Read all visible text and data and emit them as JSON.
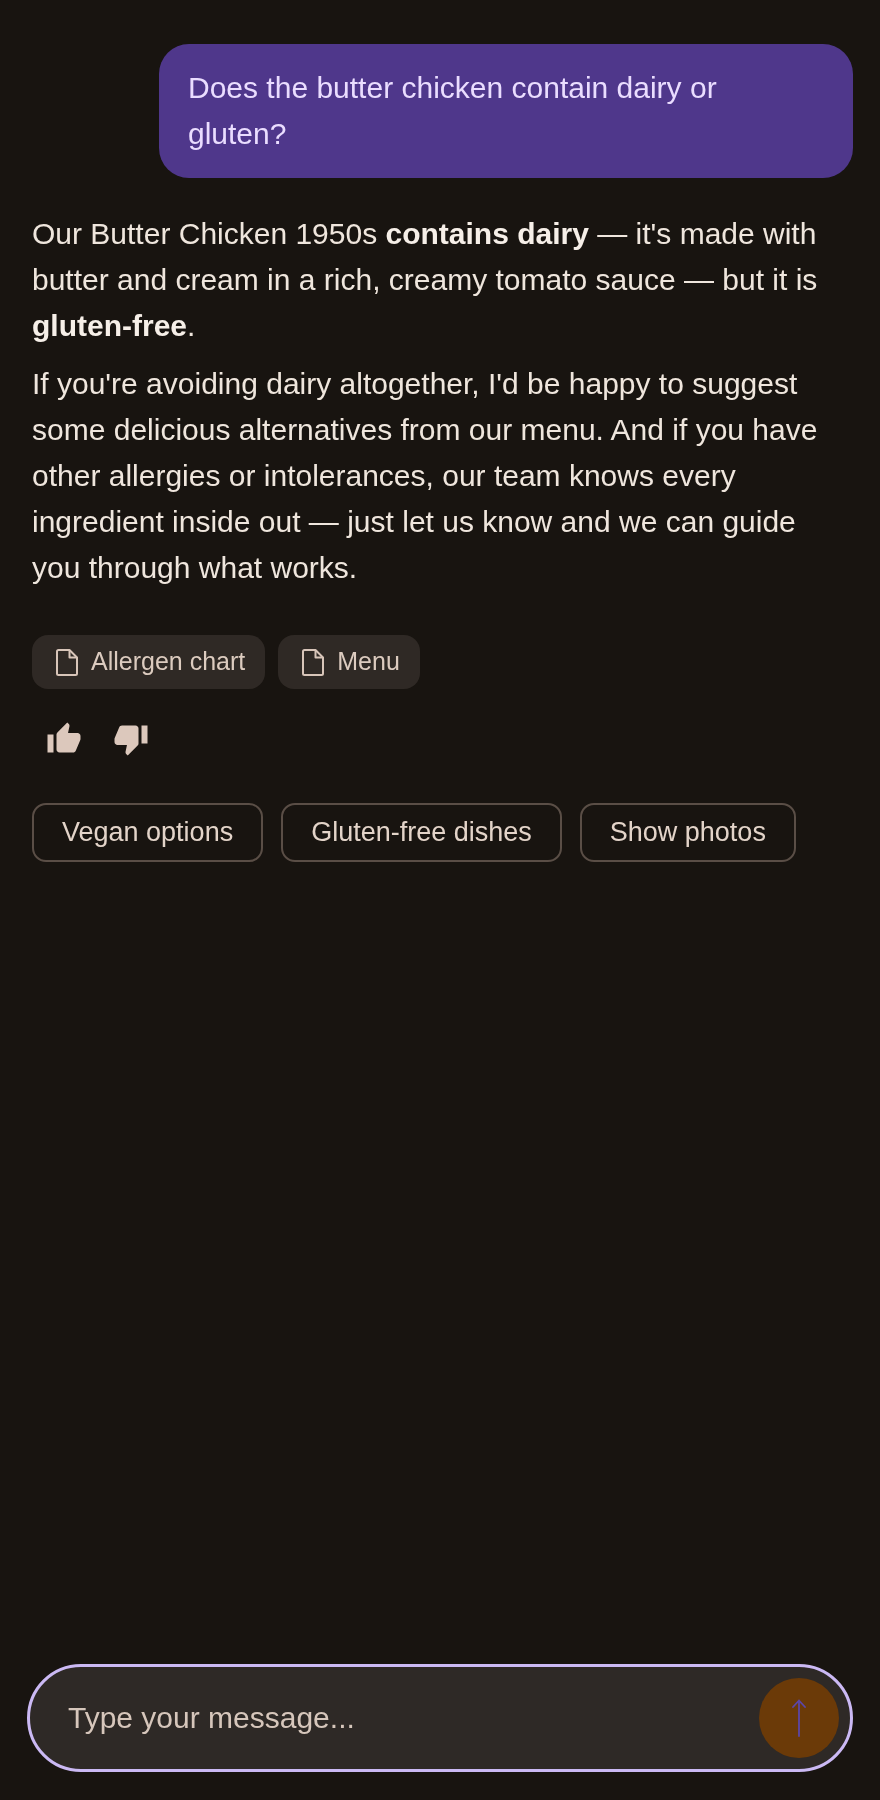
{
  "user_message": {
    "text": "Does the butter chicken contain dairy or gluten?"
  },
  "assistant_message": {
    "paragraphs": [
      "Our Butter Chicken 1950s **contains dairy** — it's made with butter and cream in a rich, creamy tomato sauce — but it is **gluten-free**.",
      "If you're avoiding dairy altogether, I'd be happy to suggest some delicious alternatives from our menu. And if you have other allergies or intolerances, our team knows every ingredient inside out — just let us know and we can guide you through what works."
    ],
    "sources": [
      {
        "label": "Allergen chart"
      },
      {
        "label": "Menu"
      }
    ]
  },
  "suggestions": [
    {
      "label": "Vegan options"
    },
    {
      "label": "Gluten-free dishes"
    },
    {
      "label": "Show photos"
    }
  ],
  "composer": {
    "placeholder": "Type your message..."
  }
}
